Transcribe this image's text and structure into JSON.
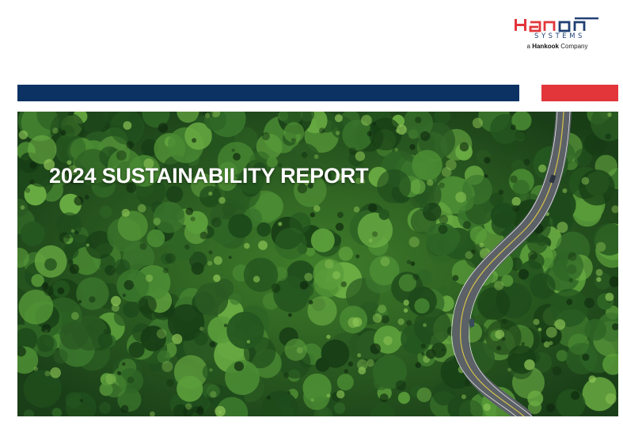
{
  "brand": {
    "wordmark": "Hanon",
    "subtitle": "SYSTEMS",
    "tagline_prefix": "a",
    "tagline_brand": "Hankook",
    "tagline_suffix": "Company",
    "colors": {
      "navy": "#1f3f73",
      "red": "#e2363a",
      "bar_blue": "#0c3264"
    }
  },
  "cover": {
    "title": "2024 SUSTAINABILITY REPORT",
    "image": "aerial forest with winding road",
    "colors": {
      "forest_dark": "#1f4a1c",
      "forest_light": "#5f9e34",
      "road": "#6e7478"
    }
  }
}
